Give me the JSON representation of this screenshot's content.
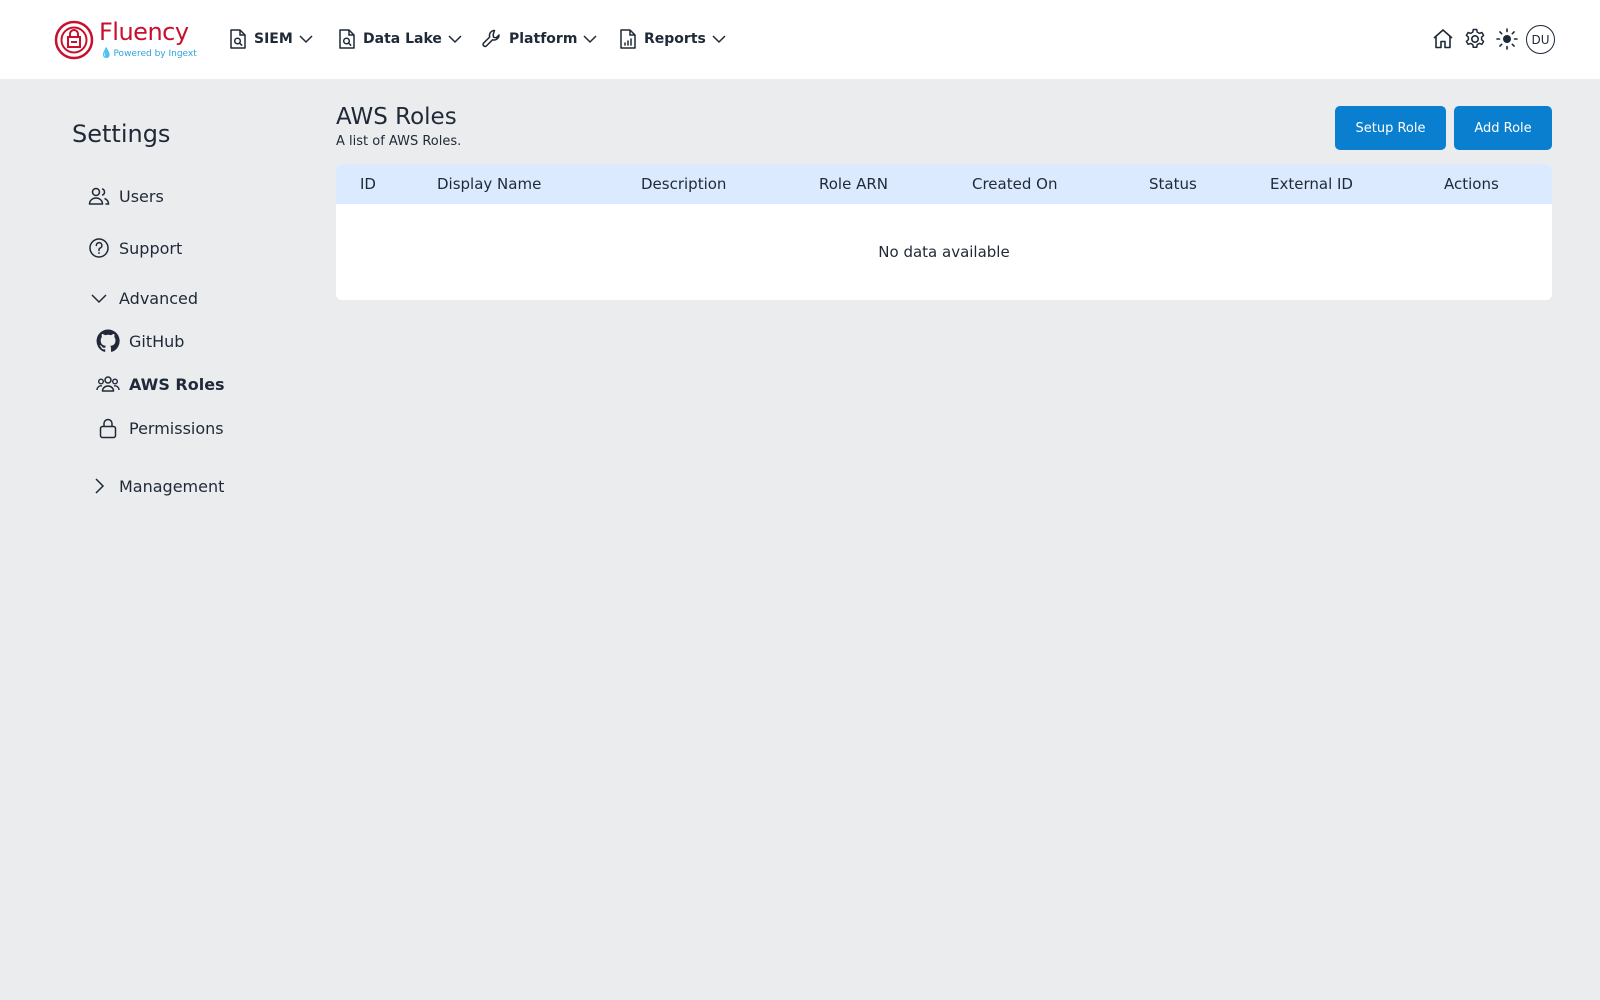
{
  "header": {
    "logo": {
      "name": "Fluency",
      "tagline": "Powered by Ingext"
    },
    "nav": [
      {
        "label": "SIEM",
        "icon": "search-document-icon"
      },
      {
        "label": "Data Lake",
        "icon": "search-document-icon"
      },
      {
        "label": "Platform",
        "icon": "wrench-icon"
      },
      {
        "label": "Reports",
        "icon": "report-document-icon"
      }
    ],
    "actions": [
      "home-icon",
      "gear-icon",
      "sun-icon"
    ],
    "avatar": "DU"
  },
  "sidebar": {
    "title": "Settings",
    "items": [
      {
        "label": "Users",
        "icon": "users-icon"
      },
      {
        "label": "Support",
        "icon": "help-circle-icon"
      },
      {
        "label": "Advanced",
        "icon": "chevron-down-icon",
        "expanded": true
      },
      {
        "label": "GitHub",
        "icon": "github-icon"
      },
      {
        "label": "AWS Roles",
        "icon": "user-group-icon",
        "active": true
      },
      {
        "label": "Permissions",
        "icon": "lock-icon"
      },
      {
        "label": "Management",
        "icon": "chevron-right-icon",
        "expanded": false
      }
    ]
  },
  "main": {
    "title": "AWS Roles",
    "subtitle": "A list of AWS Roles.",
    "buttons": {
      "setup": "Setup Role",
      "add": "Add Role"
    },
    "table": {
      "columns": [
        "ID",
        "Display Name",
        "Description",
        "Role ARN",
        "Created On",
        "Status",
        "External ID",
        "Actions"
      ],
      "rows": [],
      "empty_text": "No data available"
    }
  },
  "colors": {
    "brand_red": "#c8102e",
    "accent_blue": "#0a7fd0",
    "table_header": "#dbeafe",
    "page_bg": "#ebecee"
  }
}
